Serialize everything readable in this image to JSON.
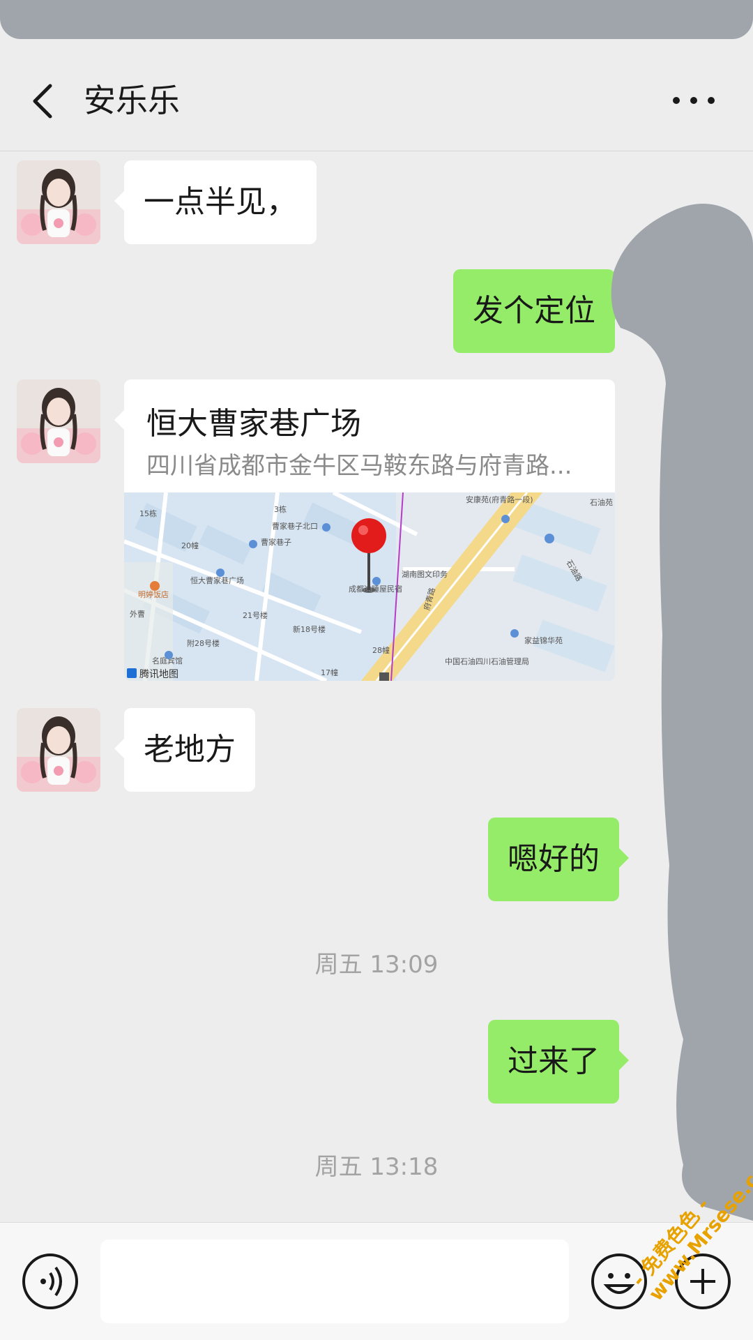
{
  "header": {
    "title": "安乐乐"
  },
  "messages": [
    {
      "side": "left",
      "text": "一点半见，"
    },
    {
      "side": "right",
      "text": "发个定位"
    },
    {
      "side": "left",
      "type": "location",
      "name": "恒大曹家巷广场",
      "address": "四川省成都市金牛区马鞍东路与府青路..."
    },
    {
      "side": "left",
      "text": "老地方"
    },
    {
      "side": "right",
      "text": "嗯好的"
    },
    {
      "type": "time",
      "text": "周五 13:09"
    },
    {
      "side": "right",
      "text": "过来了"
    },
    {
      "type": "time",
      "text": "周五 13:18"
    }
  ],
  "map": {
    "labels": {
      "l1": "15栋",
      "l2": "3栋",
      "l3": "曹家巷子北口",
      "l4": "20幢",
      "l5": "曹家巷子",
      "l6": "恒大曹家巷广场",
      "l7": "明婷饭店",
      "l8": "外曹",
      "l9": "21号楼",
      "l10": "新18号楼",
      "l11": "附28号楼",
      "l12": "名庭宾馆",
      "l13": "28幢",
      "l14": "17幢",
      "l15": "安康苑(府青路一段)",
      "l16": "湖南图文印务",
      "l17": "成都途睡屋民宿",
      "l18": "府青路",
      "l19": "家益锦华苑",
      "l20": "中国石油四川石油管理局",
      "l21": "石油苑",
      "l22": "石油路"
    },
    "attribution": "腾讯地图"
  },
  "input": {
    "placeholder": ""
  },
  "watermark": {
    "line1": "- 免费色色 -",
    "line2": "www.Mrsese.com"
  },
  "colors": {
    "background": "#ededed",
    "sent_bubble": "#95ec69",
    "received_bubble": "#ffffff",
    "redaction": "#9fa5ab"
  }
}
